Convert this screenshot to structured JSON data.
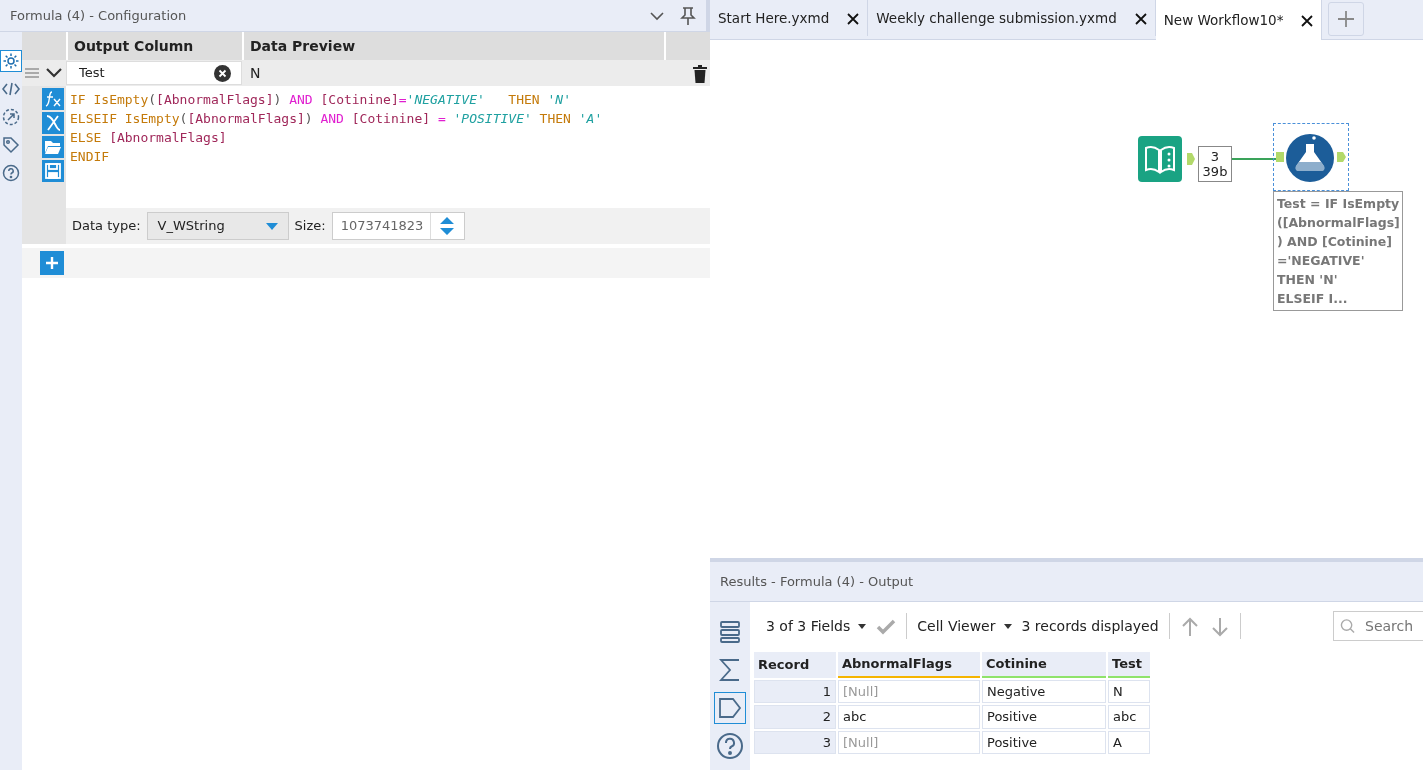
{
  "config_panel": {
    "title": "Formula (4) - Configuration",
    "side_icons": [
      {
        "kind": "gear",
        "selected": true
      },
      {
        "kind": "code",
        "selected": false
      },
      {
        "kind": "arrow",
        "selected": false
      },
      {
        "kind": "tag",
        "selected": false
      },
      {
        "kind": "help",
        "selected": false
      }
    ],
    "columns": [
      "Output Column",
      "Data Preview"
    ],
    "formula": {
      "output_column": "Test",
      "preview": "N",
      "code_lines": [
        [
          {
            "text": "IF IsEmpty",
            "kind": "keyword"
          },
          {
            "text": "(",
            "kind": "plain"
          },
          {
            "text": "[AbnormalFlags]",
            "kind": "field"
          },
          {
            "text": ") ",
            "kind": "plain"
          },
          {
            "text": "AND",
            "kind": "operator"
          },
          {
            "text": " [Cotinine]",
            "kind": "field"
          },
          {
            "text": "=",
            "kind": "operator"
          },
          {
            "text": "'NEGATIVE'",
            "kind": "string"
          },
          {
            "text": "   THEN ",
            "kind": "keyword"
          },
          {
            "text": "'N'",
            "kind": "string"
          }
        ],
        [
          {
            "text": "ELSEIF IsEmpty",
            "kind": "keyword"
          },
          {
            "text": "(",
            "kind": "plain"
          },
          {
            "text": "[AbnormalFlags]",
            "kind": "field"
          },
          {
            "text": ") ",
            "kind": "plain"
          },
          {
            "text": "AND",
            "kind": "operator"
          },
          {
            "text": " [Cotinine] ",
            "kind": "field"
          },
          {
            "text": "=",
            "kind": "operator"
          },
          {
            "text": " 'POSITIVE'",
            "kind": "string"
          },
          {
            "text": " THEN ",
            "kind": "keyword"
          },
          {
            "text": "'A'",
            "kind": "string"
          }
        ],
        [
          {
            "text": "ELSE ",
            "kind": "keyword"
          },
          {
            "text": "[AbnormalFlags]",
            "kind": "field"
          }
        ],
        [
          {
            "text": "ENDIF",
            "kind": "keyword"
          }
        ]
      ],
      "data_type_label": "Data type:",
      "data_type": "V_WString",
      "size_label": "Size:",
      "size": "1073741823"
    }
  },
  "tabs": [
    {
      "label": "Start Here.yxmd",
      "selected": false
    },
    {
      "label": "Weekly challenge submission.yxmd",
      "selected": false
    },
    {
      "label": "New Workflow10*",
      "selected": true
    }
  ],
  "canvas": {
    "connection_count": "3",
    "connection_size": "39b",
    "annotation_lines": [
      "Test = IF IsEmpty",
      "([AbnormalFlags]",
      ") AND [Cotinine]",
      "='NEGATIVE'",
      "THEN 'N'",
      "ELSEIF I..."
    ]
  },
  "results": {
    "title": "Results - Formula (4) - Output",
    "side_icons": [
      {
        "kind": "rows",
        "selected": false
      },
      {
        "kind": "sigma",
        "selected": false
      },
      {
        "kind": "tag",
        "selected": true
      },
      {
        "kind": "help",
        "selected": false
      }
    ],
    "fields_selector": "3 of 3 Fields",
    "viewer": "Cell Viewer",
    "records_displayed": "3 records displayed",
    "search_placeholder": "Search",
    "columns": [
      {
        "name": "Record"
      },
      {
        "name": "AbnormalFlags",
        "color": "#f5b400"
      },
      {
        "name": "Cotinine",
        "color": "#8fe36a"
      },
      {
        "name": "Test",
        "color": "#8fe36a"
      }
    ],
    "rows": [
      [
        {
          "text": "1",
          "null": false
        },
        {
          "text": "[Null]",
          "null": true
        },
        {
          "text": "Negative",
          "null": false
        },
        {
          "text": "N",
          "null": false
        }
      ],
      [
        {
          "text": "2",
          "null": false
        },
        {
          "text": "abc",
          "null": false
        },
        {
          "text": "Positive",
          "null": false
        },
        {
          "text": "abc",
          "null": false
        }
      ],
      [
        {
          "text": "3",
          "null": false
        },
        {
          "text": "[Null]",
          "null": true
        },
        {
          "text": "Positive",
          "null": false
        },
        {
          "text": "A",
          "null": false
        }
      ]
    ]
  }
}
